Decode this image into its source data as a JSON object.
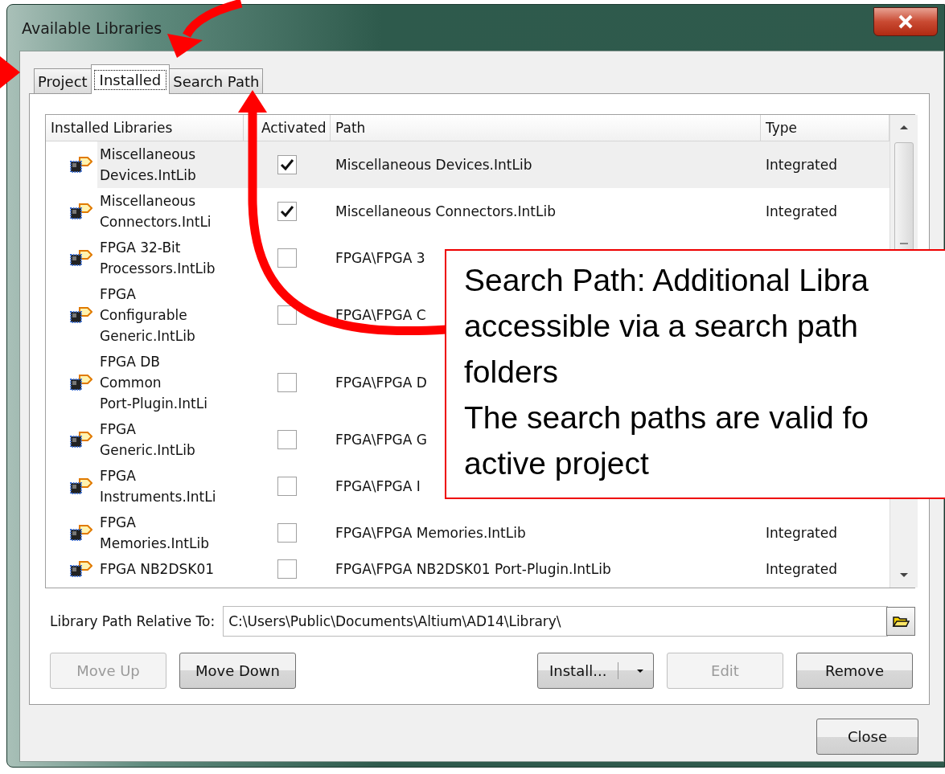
{
  "window": {
    "title": "Available Libraries"
  },
  "tabs": [
    {
      "label": "Project",
      "selected": false
    },
    {
      "label": "Installed",
      "selected": true
    },
    {
      "label": "Search Path",
      "selected": false
    }
  ],
  "table": {
    "columns": [
      "Installed Libraries",
      "Activated",
      "Path",
      "Type"
    ],
    "rows": [
      {
        "name": "Miscellaneous\nDevices.IntLib",
        "activated": true,
        "path": "Miscellaneous Devices.IntLib",
        "type": "Integrated",
        "selected": true
      },
      {
        "name": "Miscellaneous\nConnectors.IntLi",
        "activated": true,
        "path": "Miscellaneous Connectors.IntLib",
        "type": "Integrated",
        "selected": false
      },
      {
        "name": "FPGA 32-Bit\nProcessors.IntLib",
        "activated": false,
        "path": "FPGA\\FPGA 3",
        "selected": false
      },
      {
        "name": "FPGA\nConfigurable\nGeneric.IntLib",
        "activated": false,
        "path": "FPGA\\FPGA C",
        "selected": false
      },
      {
        "name": "FPGA DB\nCommon\nPort-Plugin.IntLi",
        "activated": false,
        "path": "FPGA\\FPGA D",
        "selected": false
      },
      {
        "name": "FPGA\nGeneric.IntLib",
        "activated": false,
        "path": "FPGA\\FPGA G",
        "selected": false
      },
      {
        "name": "FPGA\nInstruments.IntLi",
        "activated": false,
        "path": "FPGA\\FPGA I",
        "selected": false
      },
      {
        "name": "FPGA\nMemories.IntLib",
        "activated": false,
        "path": "FPGA\\FPGA Memories.IntLib",
        "type": "Integrated",
        "selected": false
      },
      {
        "name": "FPGA NB2DSK01",
        "activated": false,
        "path": "FPGA\\FPGA NB2DSK01 Port-Plugin.IntLib",
        "type": "Integrated",
        "selected": false
      }
    ]
  },
  "library_path": {
    "label": "Library Path Relative To:",
    "value": "C:\\Users\\Public\\Documents\\Altium\\AD14\\Library\\"
  },
  "buttons": [
    {
      "label": "Move Up",
      "disabled": true,
      "kind": "push"
    },
    {
      "label": "Move Down",
      "disabled": false,
      "kind": "push"
    },
    {
      "label": "Install...",
      "disabled": false,
      "kind": "split"
    },
    {
      "label": "Edit",
      "disabled": true,
      "kind": "push"
    },
    {
      "label": "Remove",
      "disabled": false,
      "kind": "push"
    }
  ],
  "close_button": {
    "label": "Close"
  },
  "callout": {
    "text": "Search Path: Additional Libra\naccessible via a search path\nfolders\nThe search paths are valid fo\nactive project"
  }
}
